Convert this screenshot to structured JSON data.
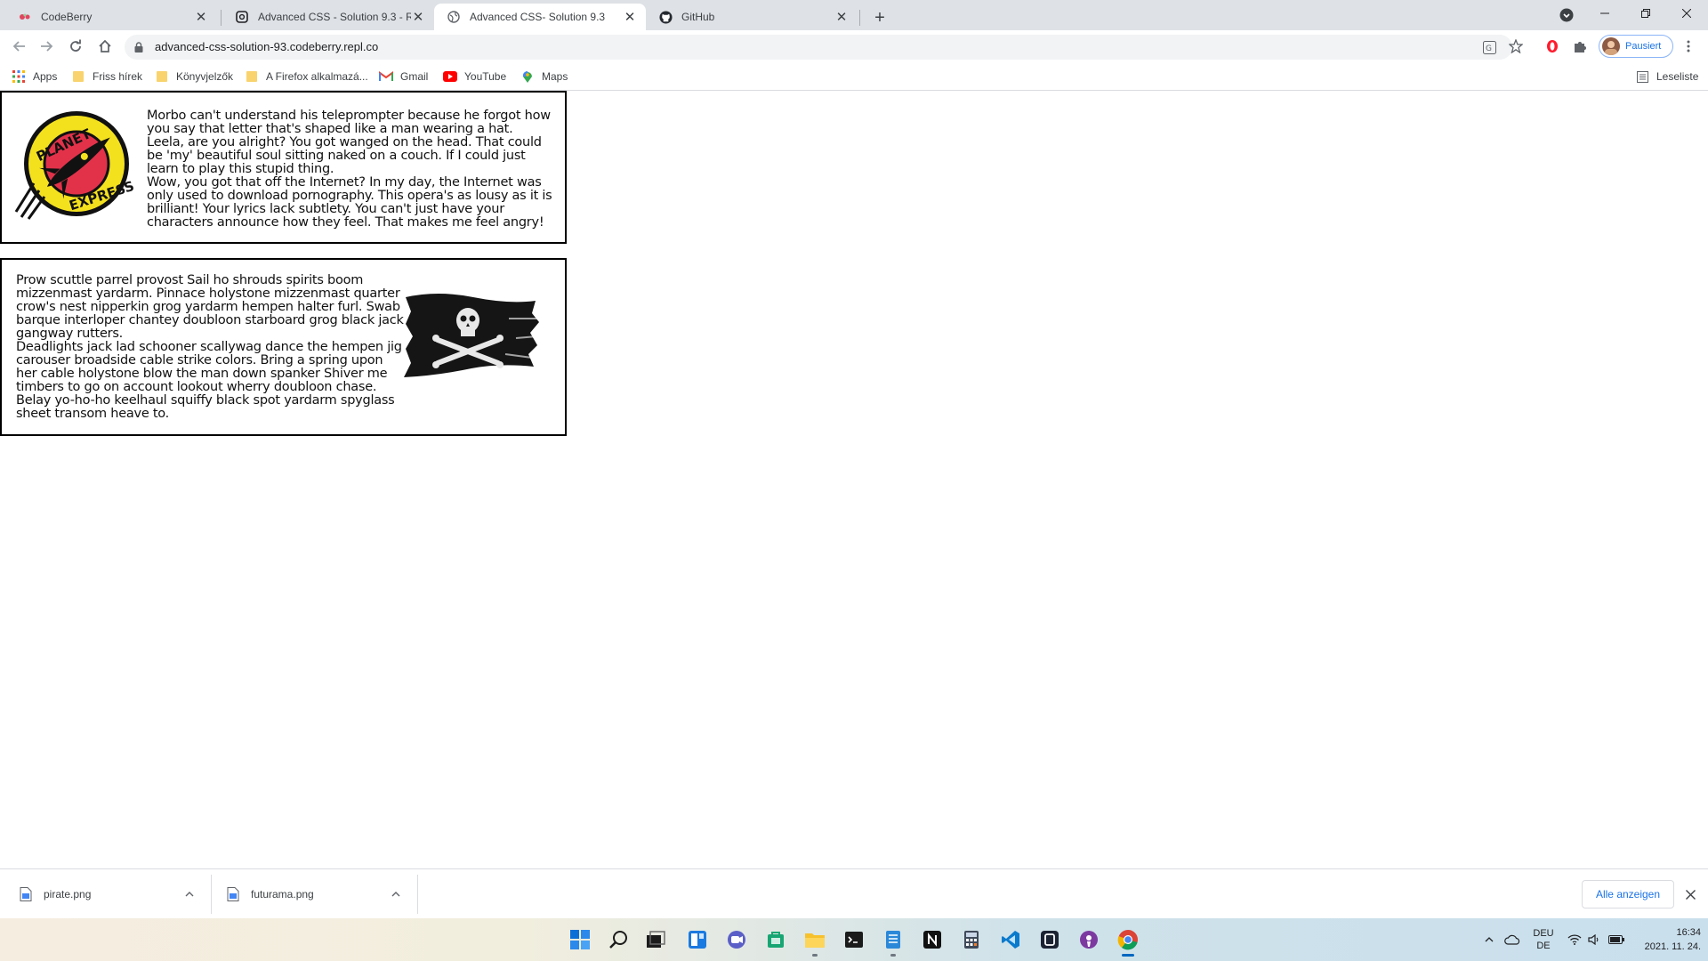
{
  "browser": {
    "tabs": [
      {
        "title": "CodeBerry",
        "icon": "codeberry-icon",
        "active": false
      },
      {
        "title": "Advanced CSS - Solution 9.3 - Re",
        "icon": "replit-icon",
        "active": false
      },
      {
        "title": "Advanced CSS- Solution 9.3",
        "icon": "globe-icon",
        "active": true
      },
      {
        "title": "GitHub",
        "icon": "github-icon",
        "active": false
      }
    ],
    "new_tab_label": "+",
    "url": "advanced-css-solution-93.codeberry.repl.co",
    "profile_label": "Pausiert",
    "bookmarks": [
      {
        "label": "Apps",
        "icon": "apps-grid-icon"
      },
      {
        "label": "Friss hírek",
        "icon": "folder-icon"
      },
      {
        "label": "Könyvjelzők",
        "icon": "folder-icon"
      },
      {
        "label": "A Firefox alkalmazá...",
        "icon": "folder-icon"
      },
      {
        "label": "Gmail",
        "icon": "gmail-icon"
      },
      {
        "label": "YouTube",
        "icon": "youtube-icon"
      },
      {
        "label": "Maps",
        "icon": "maps-icon"
      }
    ],
    "reading_list_label": "Leseliste"
  },
  "page": {
    "card1_text": [
      "Morbo can't understand his teleprompter because he forgot how you say that letter that's shaped like a man wearing a hat. Leela, are you alright? You got wanged on the head. That could be 'my' beautiful soul sitting naked on a couch. If I could just learn to play this stupid thing.",
      "Wow, you got that off the Internet? In my day, the Internet was only used to download pornography. This opera's as lousy as it is brilliant! Your lyrics lack subtlety. You can't just have your characters announce how they feel. That makes me feel angry!"
    ],
    "logo_words": [
      "PLANET",
      "EXPRESS"
    ],
    "card2_text": [
      "Prow scuttle parrel provost Sail ho shrouds spirits boom mizzenmast yardarm. Pinnace holystone mizzenmast quarter crow's nest nipperkin grog yardarm hempen halter furl. Swab barque interloper chantey doubloon starboard grog black jack gangway rutters.",
      "Deadlights jack lad schooner scallywag dance the hempen jig carouser broadside cable strike colors. Bring a spring upon her cable holystone blow the man down spanker Shiver me timbers to go on account lookout wherry doubloon chase. Belay yo-ho-ho keelhaul squiffy black spot yardarm spyglass sheet transom heave to."
    ]
  },
  "downloads": {
    "items": [
      {
        "name": "pirate.png"
      },
      {
        "name": "futurama.png"
      }
    ],
    "show_all_label": "Alle anzeigen"
  },
  "taskbar": {
    "apps": [
      "windows-start-icon",
      "search-icon",
      "task-view-icon",
      "widgets-icon",
      "teams-chat-icon",
      "store-icon",
      "file-explorer-icon",
      "terminal-icon",
      "notepad-icon",
      "notion-icon",
      "calculator-icon",
      "vscode-icon",
      "replit-app-icon",
      "podcast-icon",
      "chrome-icon"
    ],
    "lang_top": "DEU",
    "lang_bottom": "DE",
    "time": "16:34",
    "date": "2021. 11. 24."
  },
  "colors": {
    "tabstrip": "#dee1e6",
    "link_blue": "#1a73e8",
    "card_border": "#000000"
  }
}
